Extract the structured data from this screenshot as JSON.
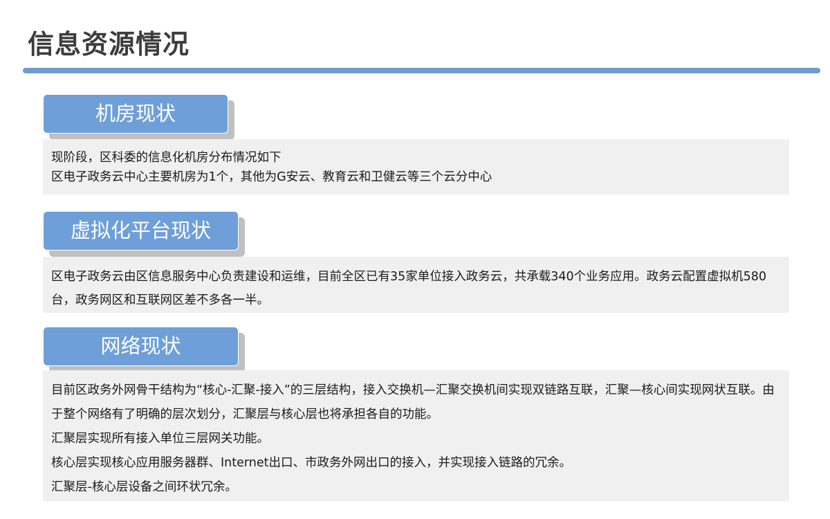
{
  "page": {
    "title": "信息资源情况"
  },
  "sections": [
    {
      "heading": "机房现状",
      "paragraphs": [
        "现阶段，区科委的信息化机房分布情况如下",
        "区电子政务云中心主要机房为1个，其他为G安云、教育云和卫健云等三个云分中心"
      ]
    },
    {
      "heading": "虚拟化平台现状",
      "paragraphs": [
        "区电子政务云由区信息服务中心负责建设和运维，目前全区已有35家单位接入政务云，共承载340个业务应用。政务云配置虚拟机580台，政务网区和互联网区差不多各一半。"
      ]
    },
    {
      "heading": "网络现状",
      "paragraphs": [
        "目前区政务外网骨干结构为“核心-汇聚-接入”的三层结构，接入交换机—汇聚交换机间实现双链路互联，汇聚—核心间实现网状互联。由于整个网络有了明确的层次划分，汇聚层与核心层也将承担各自的功能。",
        "汇聚层实现所有接入单位三层网关功能。",
        "核心层实现核心应用服务器群、Internet出口、市政务外网出口的接入，并实现接入链路的冗余。",
        "汇聚层-核心层设备之间环状冗余。"
      ]
    }
  ],
  "colors": {
    "accent": "#6e9fd8",
    "rule": "#6f9bd1",
    "content_bg": "#f0f0f0",
    "tab_shadow": "#c0c0c0"
  }
}
